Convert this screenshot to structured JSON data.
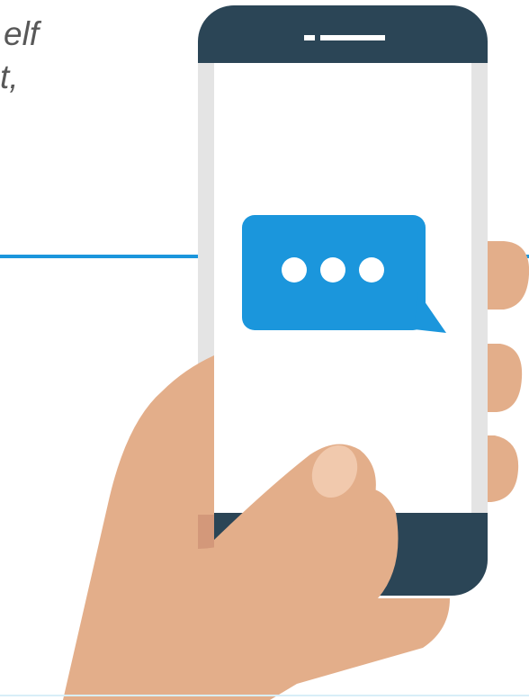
{
  "text_fragment": {
    "line_1": "elf",
    "line_2": "t,"
  },
  "icons": {
    "illustration": "hand-holding-phone",
    "message_bubble": "chat-bubble-typing-icon",
    "typing_dots": 3
  },
  "colors": {
    "background": "#ffffff",
    "text": "#585858",
    "accent_line": "#1b96dc",
    "bubble": "#1b96dc",
    "phone_body": "#2b4556",
    "phone_screen": "#ffffff",
    "phone_side": "#e4e4e4",
    "skin": "#e3ae8a",
    "skin_shadow": "#d3987a",
    "thumbnail": "#f1c9ad"
  }
}
